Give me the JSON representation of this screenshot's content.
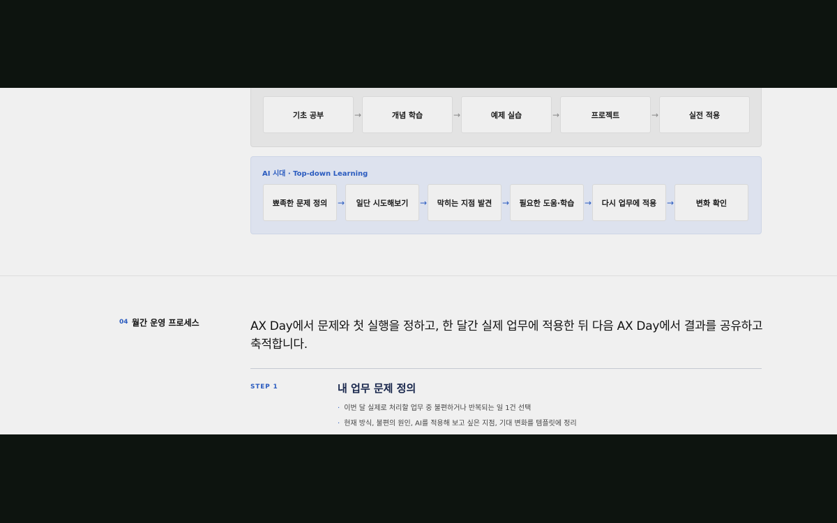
{
  "traditional_flow": {
    "steps": [
      "기초 공부",
      "개념 학습",
      "예제 실습",
      "프로젝트",
      "실전 적용"
    ],
    "arrow": "→"
  },
  "ai_flow": {
    "title": "AI 시대 · Top-down Learning",
    "steps": [
      "뾰족한 문제 정의",
      "일단 시도해보기",
      "막히는 지점 발견",
      "필요한 도움·학습",
      "다시 업무에 적용",
      "변화 확인"
    ],
    "arrow": "→"
  },
  "section": {
    "number": "04",
    "title": "월간 운영 프로세스",
    "headline": "AX Day에서 문제와 첫 실행을 정하고, 한 달간 실제 업무에 적용한 뒤 다음 AX Day에서 결과를 공유하고 축적합니다."
  },
  "step1": {
    "label": "STEP 1",
    "title": "내 업무 문제 정의",
    "bullets": [
      "이번 달 실제로 처리할 업무 중 불편하거나 반복되는 일 1건 선택",
      "현재 방식, 불편의 원인, AI를 적용해 보고 싶은 지점, 기대 변화를 템플릿에 정리"
    ],
    "bullet_marker": "·"
  },
  "colors": {
    "accent": "#2a5bbf",
    "page_bg": "#f0f0f0",
    "letterbox": "#0d140f"
  }
}
